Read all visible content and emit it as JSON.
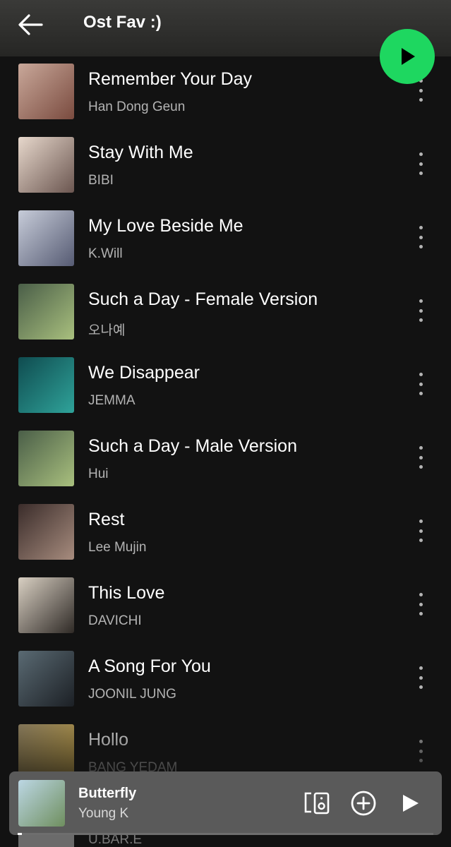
{
  "header": {
    "title": "Ost Fav :)"
  },
  "tracks": [
    {
      "title": "Remember Your Day",
      "artist": "Han Dong Geun",
      "cover_colors": [
        "#c9a89a",
        "#7a4b3f"
      ]
    },
    {
      "title": "Stay With Me",
      "artist": "BIBI",
      "cover_colors": [
        "#e7d8cc",
        "#6b5650"
      ]
    },
    {
      "title": "My Love Beside Me",
      "artist": "K.Will",
      "cover_colors": [
        "#c7ccd9",
        "#565b73"
      ]
    },
    {
      "title": "Such a Day - Female Version",
      "artist": "오나예",
      "cover_colors": [
        "#4a5e48",
        "#a9c07e"
      ]
    },
    {
      "title": "We Disappear",
      "artist": "JEMMA",
      "cover_colors": [
        "#0f4b4f",
        "#2fa39a"
      ]
    },
    {
      "title": "Such a Day - Male Version",
      "artist": "Hui",
      "cover_colors": [
        "#4a5e48",
        "#a9c07e"
      ]
    },
    {
      "title": "Rest",
      "artist": "Lee Mujin",
      "cover_colors": [
        "#3a2c2a",
        "#a78c7e"
      ]
    },
    {
      "title": "This Love",
      "artist": "DAVICHI",
      "cover_colors": [
        "#d9d0c3",
        "#2f2a26"
      ]
    },
    {
      "title": "A Song For You",
      "artist": "JOONIL JUNG",
      "cover_colors": [
        "#5a6a73",
        "#1c2025"
      ]
    },
    {
      "title": "Hollo",
      "artist": "BANG YEDAM",
      "cover_colors": [
        "#9d8d6a",
        "#e1b94a"
      ]
    }
  ],
  "next_track_peek": {
    "artist": "U.BAR.E"
  },
  "now_playing": {
    "title": "Butterfly",
    "artist": "Young K",
    "progress": 0.01,
    "cover_colors": [
      "#bcd7e4",
      "#6f8f5f"
    ]
  },
  "colors": {
    "accent": "#1ed760",
    "background": "#121212",
    "secondary_text": "#b3b3b3",
    "mini_player_bg": "#5a5a5a"
  },
  "icons": {
    "back": "arrow-left-icon",
    "play": "play-icon",
    "more": "more-vertical-icon",
    "devices": "connect-device-icon",
    "add": "plus-circle-icon"
  }
}
